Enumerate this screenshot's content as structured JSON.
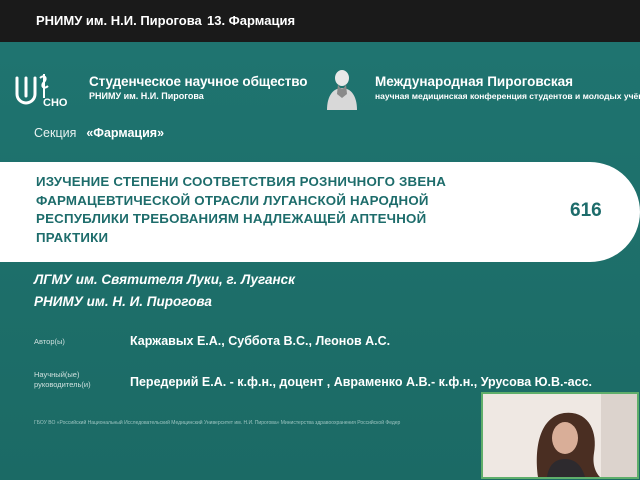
{
  "topbar": {
    "institution": "РНИМУ им. Н.И. Пирогова",
    "section_title": "13. Фармация"
  },
  "header": {
    "logo_text": "СНО",
    "society_name": "Студенческое научное общество",
    "society_sub": "РНИМУ им. Н.И. Пирогова",
    "conf_name": "Международная Пироговская",
    "conf_sub": "научная медицинская конференция студентов и молодых учёны"
  },
  "section": {
    "label": "Секция",
    "value": "«Фармация»"
  },
  "talk": {
    "title_lines": [
      "ИЗУЧЕНИЕ СТЕПЕНИ СООТВЕТСТВИЯ РОЗНИЧНОГО ЗВЕНА",
      "ФАРМАЦЕВТИЧЕСКОЙ ОТРАСЛИ ЛУГАНСКОЙ НАРОДНОЙ",
      "РЕСПУБЛИКИ ТРЕБОВАНИЯМ НАДЛЕЖАЩЕЙ АПТЕЧНОЙ",
      "ПРАКТИКИ"
    ],
    "number": "616"
  },
  "institutions": [
    "ЛГМУ им. Святителя Луки, г. Луганск",
    "РНИМУ им. Н. И. Пирогова"
  ],
  "authors": {
    "label": "Автор(ы)",
    "value": "Каржавых Е.А., Суббота В.С., Леонов А.С."
  },
  "supervisors": {
    "label_line1": "Научный(ые)",
    "label_line2": "руководитель(и)",
    "value": "Передерий Е.А. - к.ф.н., доцент , Авраменко А.В.- к.ф.н., Урусова Ю.В.-асс."
  },
  "footer": {
    "text": "ГБОУ ВО «Российский Национальный Исследовательский Медицинский Университет им. Н.И. Пирогова» Министерства здравоохранения Российской Федер"
  },
  "colors": {
    "slide_bg": "#1e6e6a",
    "band": "#ffffff",
    "title_text": "#1d6c6b",
    "topbar": "#1a1a1a",
    "webcam_border": "#5fae6b"
  }
}
